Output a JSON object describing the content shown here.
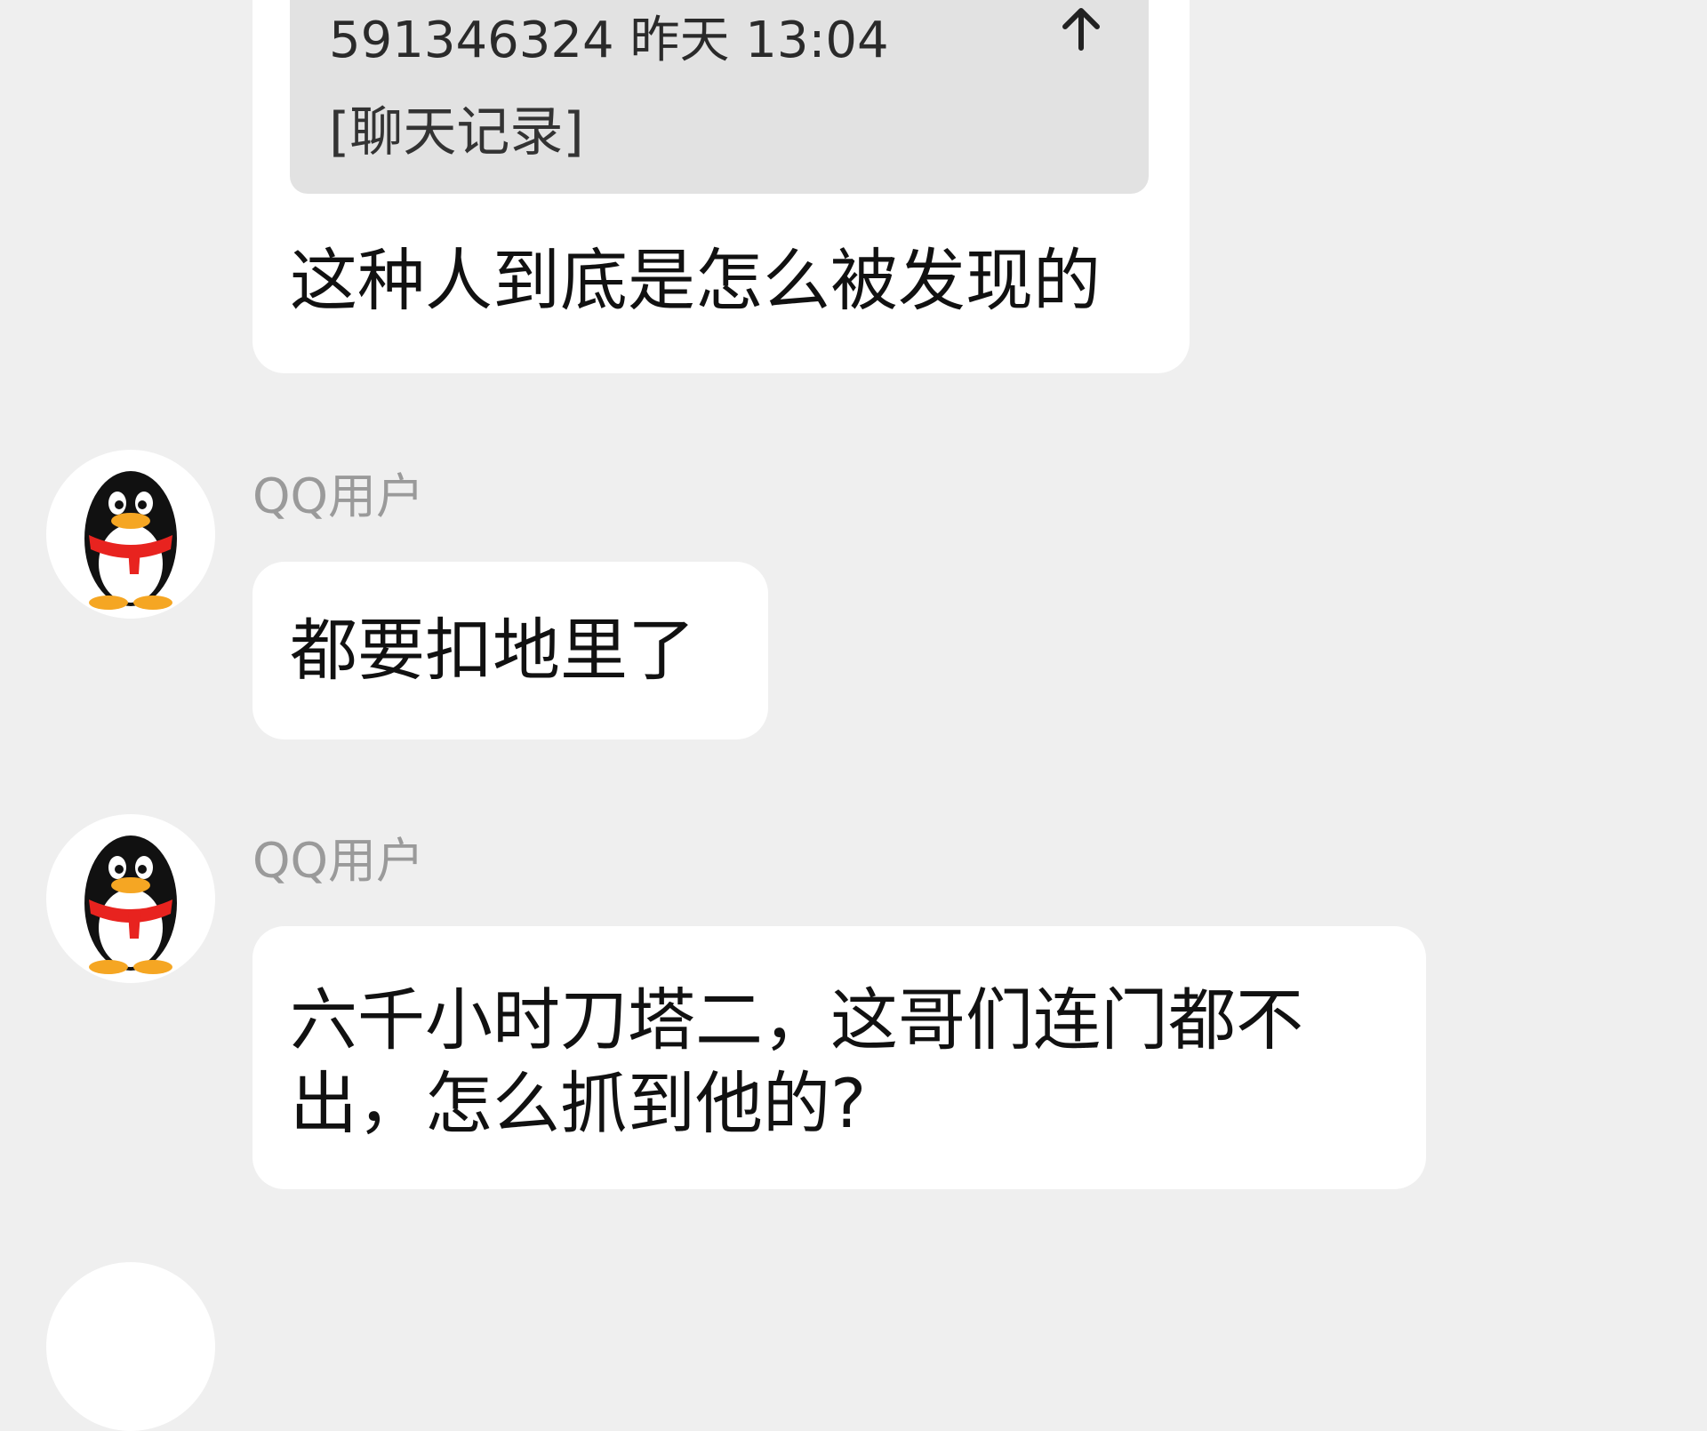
{
  "quoted_message": {
    "meta": "591346324 昨天 13:04",
    "content": "[聊天记录]",
    "reply_text": "这种人到底是怎么被发现的"
  },
  "messages": [
    {
      "sender": "QQ用户",
      "text": "都要扣地里了",
      "avatar_icon": "qq-penguin-icon"
    },
    {
      "sender": "QQ用户",
      "text_line1": "六千小时刀塔二，这哥们连门都不",
      "text_line2": "出，怎么抓到他的?",
      "avatar_icon": "qq-penguin-icon"
    }
  ],
  "colors": {
    "background": "#efefef",
    "bubble": "#ffffff",
    "quote_box": "#e2e2e2",
    "sender_name": "#9a9a9a",
    "penguin_scarf": "#e8231f",
    "penguin_beak": "#f5a623"
  }
}
